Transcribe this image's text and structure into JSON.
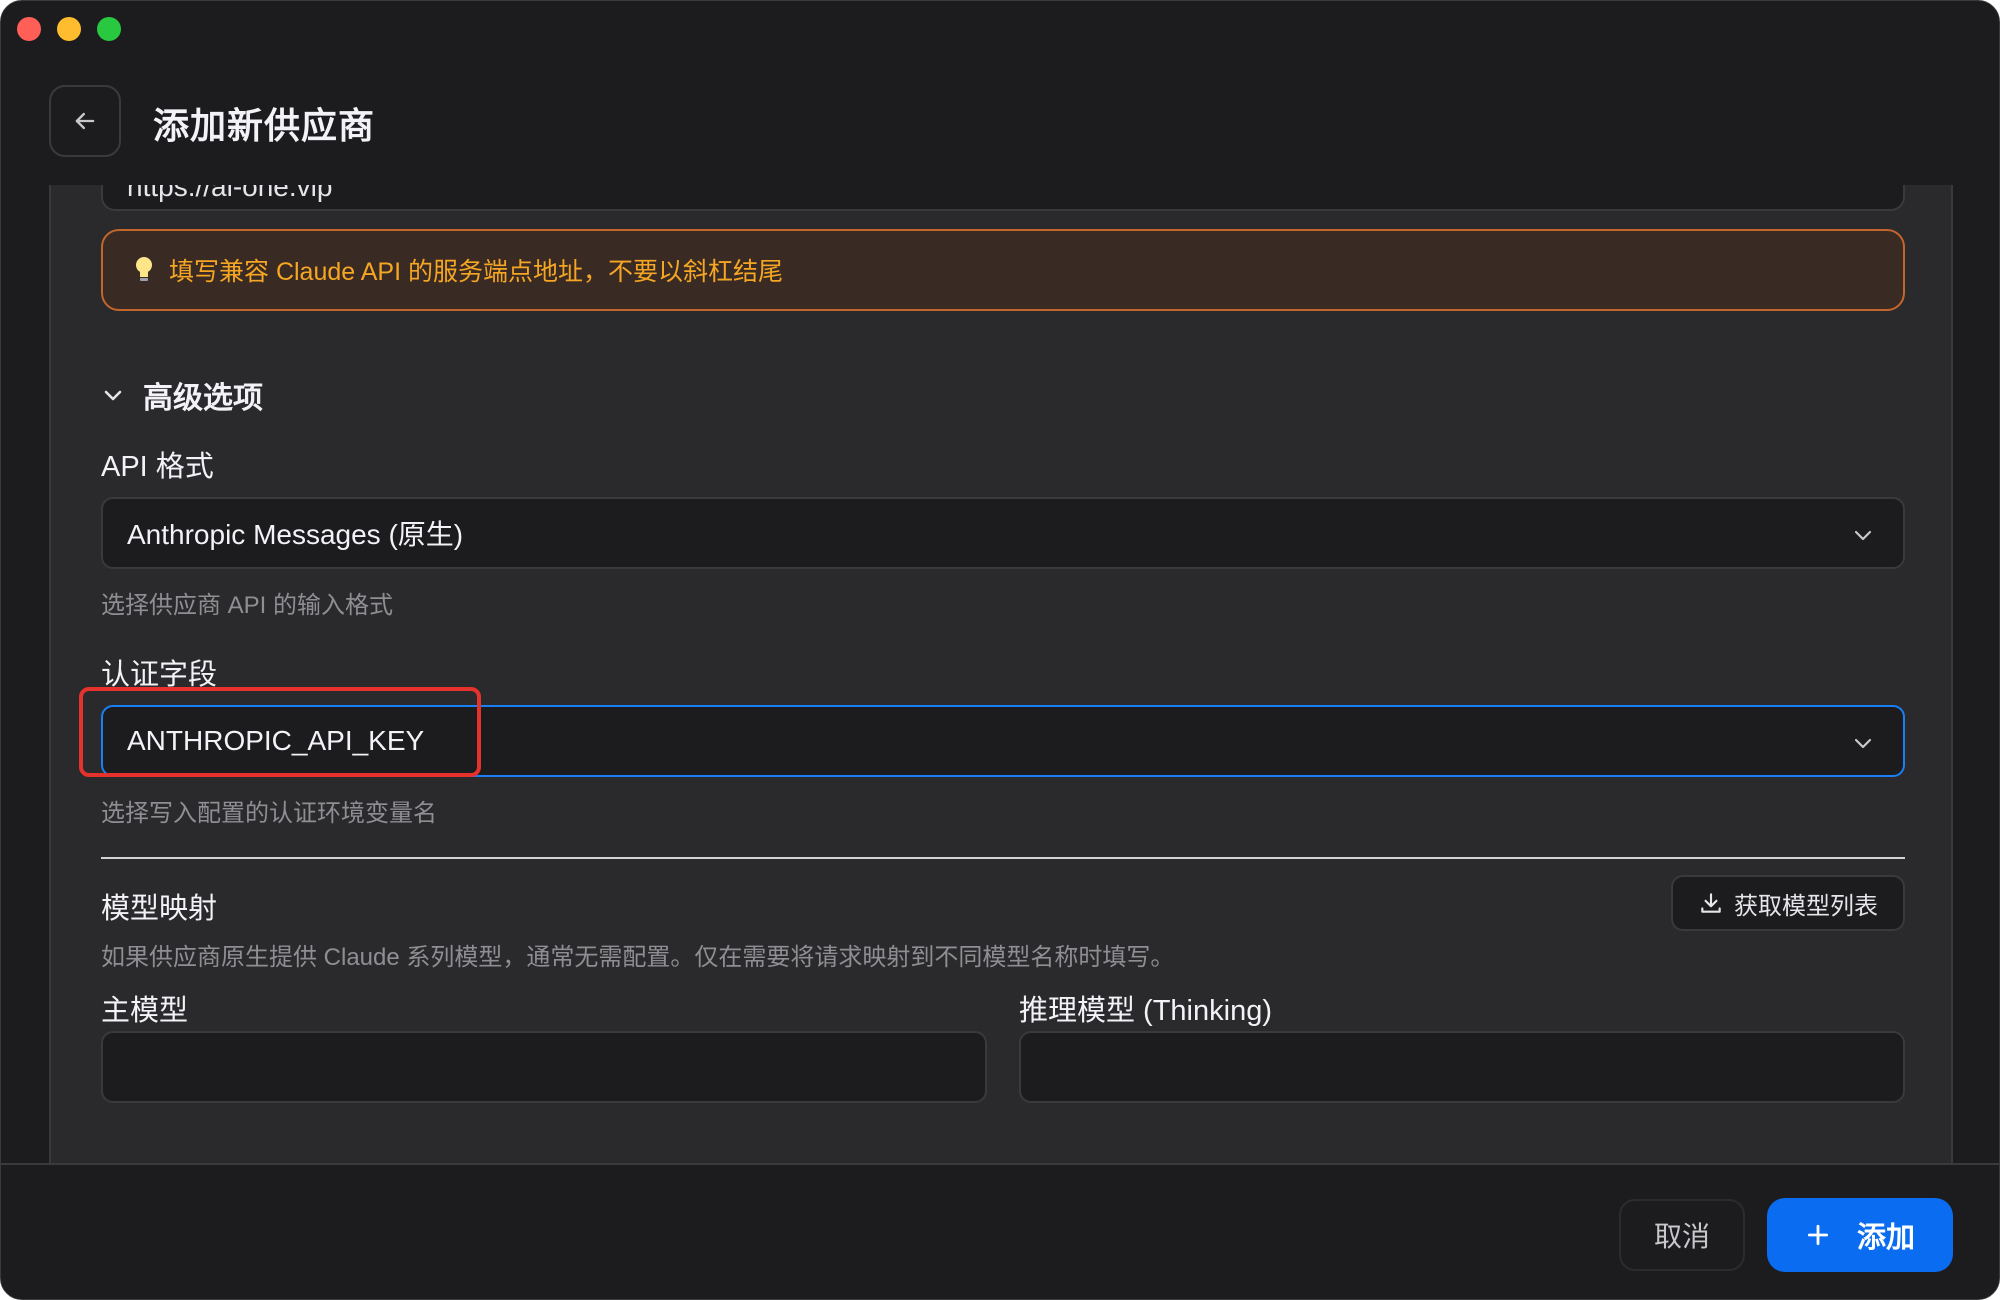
{
  "window": {
    "title": "添加新供应商"
  },
  "endpoint": {
    "value": "https://ai-one.vip",
    "hint": "填写兼容 Claude API 的服务端点地址，不要以斜杠结尾"
  },
  "advanced": {
    "toggle_label": "高级选项",
    "api_format": {
      "label": "API 格式",
      "value": "Anthropic Messages (原生)",
      "help": "选择供应商 API 的输入格式"
    },
    "auth_field": {
      "label": "认证字段",
      "value": "ANTHROPIC_API_KEY",
      "help": "选择写入配置的认证环境变量名"
    }
  },
  "model_mapping": {
    "title": "模型映射",
    "fetch_button": "获取模型列表",
    "description": "如果供应商原生提供 Claude 系列模型，通常无需配置。仅在需要将请求映射到不同模型名称时填写。",
    "main_model_label": "主模型",
    "main_model_value": "",
    "reasoning_model_label": "推理模型 (Thinking)",
    "reasoning_model_value": ""
  },
  "footer": {
    "cancel_label": "取消",
    "add_label": "添加"
  },
  "colors": {
    "accent": "#0a6cf0",
    "focus_border": "#1a7ff5",
    "warning_text": "#f5a623",
    "warning_border": "#c2662b",
    "highlight": "#e5322d"
  }
}
